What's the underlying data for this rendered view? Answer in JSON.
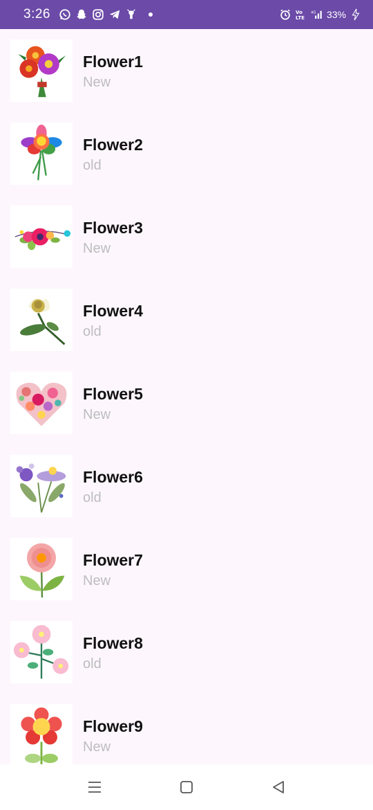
{
  "status_bar": {
    "time": "3:26",
    "battery": "33%",
    "network": "4G",
    "icons_left": [
      "whatsapp-icon",
      "snapchat-icon",
      "instagram-icon",
      "telegram-icon",
      "notification-icon"
    ],
    "icons_right": [
      "alarm-icon",
      "volte-icon",
      "signal-icon",
      "battery-charging-icon"
    ],
    "background": "#6b4aa8"
  },
  "list": {
    "items": [
      {
        "title": "Flower1",
        "subtitle": "New",
        "image": "flower-bouquet-image"
      },
      {
        "title": "Flower2",
        "subtitle": "old",
        "image": "colorful-flower-image"
      },
      {
        "title": "Flower3",
        "subtitle": "New",
        "image": "floral-garland-image"
      },
      {
        "title": "Flower4",
        "subtitle": "old",
        "image": "rose-bud-image"
      },
      {
        "title": "Flower5",
        "subtitle": "New",
        "image": "flower-heart-image"
      },
      {
        "title": "Flower6",
        "subtitle": "old",
        "image": "purple-daisy-image"
      },
      {
        "title": "Flower7",
        "subtitle": "New",
        "image": "pink-flower-image"
      },
      {
        "title": "Flower8",
        "subtitle": "old",
        "image": "pink-blossoms-image"
      },
      {
        "title": "Flower9",
        "subtitle": "New",
        "image": "red-flower-image"
      }
    ]
  },
  "nav_bar": {
    "buttons": [
      "menu-icon",
      "home-icon",
      "back-icon"
    ]
  }
}
